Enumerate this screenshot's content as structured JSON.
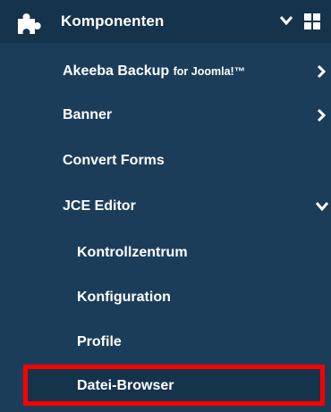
{
  "menu": {
    "header": {
      "label": "Komponenten",
      "icon": "puzzle-icon",
      "expand_icon": "chevron-down-icon",
      "side_icon": "grid-icon"
    },
    "items": [
      {
        "label": "Akeeba Backup",
        "suffix": "for Joomla!™",
        "icon": "chevron-right-icon"
      },
      {
        "label": "Banner",
        "icon": "chevron-right-icon"
      },
      {
        "label": "Convert Forms"
      },
      {
        "label": "JCE Editor",
        "icon": "chevron-down-icon"
      }
    ],
    "subitems": [
      {
        "label": "Kontrollzentrum"
      },
      {
        "label": "Konfiguration"
      },
      {
        "label": "Profile"
      },
      {
        "label": "Datei-Browser",
        "highlighted": true
      }
    ]
  },
  "colors": {
    "background": "#1c3d5a",
    "header_background": "#16334c",
    "text": "#ffffff",
    "highlight_border": "#ff0000"
  }
}
